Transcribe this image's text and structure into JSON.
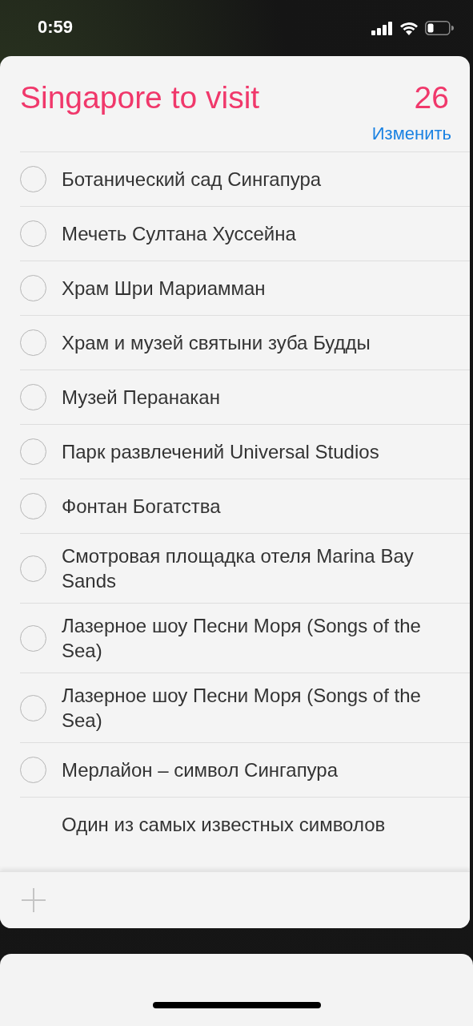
{
  "status_bar": {
    "time": "0:59"
  },
  "list": {
    "title": "Singapore to visit",
    "count": "26",
    "edit": "Изменить"
  },
  "items": [
    {
      "kind": "task",
      "text": "Ботанический сад Сингапура",
      "checked": false
    },
    {
      "kind": "task",
      "text": "Мечеть Султана Хуссейна",
      "checked": false
    },
    {
      "kind": "task",
      "text": "Храм Шри Мариамман",
      "checked": false
    },
    {
      "kind": "task",
      "text": "Храм и музей святыни зуба Будды",
      "checked": false
    },
    {
      "kind": "task",
      "text": "Музей Перанакан",
      "checked": false
    },
    {
      "kind": "task",
      "text": "Парк развлечений Universal Studios",
      "checked": false
    },
    {
      "kind": "task",
      "text": "Фонтан Богатства",
      "checked": false
    },
    {
      "kind": "task",
      "text": "Смотровая площадка отеля Marina Bay Sands",
      "checked": false
    },
    {
      "kind": "task",
      "text": "Лазерное шоу Песни Моря (Songs of the Sea)",
      "checked": false
    },
    {
      "kind": "task",
      "text": "Лазерное шоу Песни Моря (Songs of the Sea)",
      "checked": false
    },
    {
      "kind": "task",
      "text": "Мерлайон – символ Сингапура",
      "checked": false
    },
    {
      "kind": "note",
      "text": "Один из самых известных символов"
    }
  ]
}
